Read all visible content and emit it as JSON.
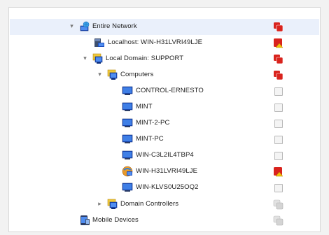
{
  "tree": {
    "rows": [
      {
        "label": "Entire Network",
        "icon": "network-icon",
        "expander": "expanded",
        "status": "red-group",
        "selected": true
      },
      {
        "label": "Localhost: WIN-H31LVRI49LJE",
        "icon": "localhost-icon",
        "expander": "none",
        "status": "red-warning"
      },
      {
        "label": "Local Domain: SUPPORT",
        "icon": "domain-icon",
        "expander": "expanded",
        "status": "red-group"
      },
      {
        "label": "Computers",
        "icon": "computers-folder-icon",
        "expander": "expanded",
        "status": "red-group"
      },
      {
        "label": "CONTROL-ERNESTO",
        "icon": "computer-icon",
        "expander": "none",
        "status": "gray"
      },
      {
        "label": "MINT",
        "icon": "computer-icon",
        "expander": "none",
        "status": "gray"
      },
      {
        "label": "MINT-2-PC",
        "icon": "computer-icon",
        "expander": "none",
        "status": "gray"
      },
      {
        "label": "MINT-PC",
        "icon": "computer-icon",
        "expander": "none",
        "status": "gray"
      },
      {
        "label": "WIN-C3L2IL4TBP4",
        "icon": "computer-icon",
        "expander": "none",
        "status": "gray"
      },
      {
        "label": "WIN-H31LVRI49LJE",
        "icon": "server-icon",
        "expander": "none",
        "status": "red-warning"
      },
      {
        "label": "WIN-KLVS0U25OQ2",
        "icon": "computer-icon",
        "expander": "none",
        "status": "gray"
      },
      {
        "label": "Domain Controllers",
        "icon": "domain-controllers-folder-icon",
        "expander": "collapsed",
        "status": "gray-group"
      },
      {
        "label": "Mobile Devices",
        "icon": "mobile-devices-icon",
        "expander": "none",
        "status": "gray-group"
      }
    ]
  },
  "colors": {
    "selected_row": "#eaf0fb",
    "status_red": "#d9231d",
    "status_warning": "#f3c20a",
    "status_gray": "#c9c9c9",
    "monitor_blue": "#1d4fc0"
  }
}
